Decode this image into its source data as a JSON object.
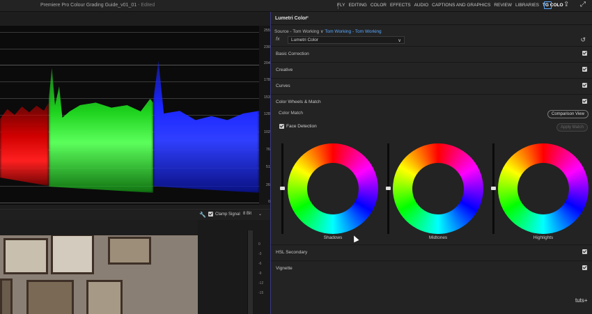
{
  "app": {
    "title": "Premiere Pro Colour Grading Guide_v01_01",
    "status": "- Edited"
  },
  "workspace_tabs": [
    "FLY",
    "EDITING",
    "COLOR",
    "EFFECTS",
    "AUDIO",
    "CAPTIONS AND GRAPHICS",
    "REVIEW",
    "LIBRARIES",
    "TG COLO"
  ],
  "workspace_active": "TG COLO",
  "scope": {
    "type": "RGB parade",
    "y_labels": [
      "255",
      "230",
      "204",
      "178",
      "153",
      "128",
      "102",
      "76",
      "51",
      "26",
      "0"
    ],
    "channels": [
      {
        "name": "red",
        "color": "#ff1a1a"
      },
      {
        "name": "green",
        "color": "#22dd22"
      },
      {
        "name": "blue",
        "color": "#2233ff"
      }
    ]
  },
  "scope_tools": {
    "clamp_label": "Clamp Signal",
    "clamp_checked": true,
    "bit_depth": "8 Bit"
  },
  "meter": {
    "labels": [
      "0",
      "-3",
      "-6",
      "-9",
      "-12",
      "-15"
    ]
  },
  "lumetri": {
    "panel_title": "Lumetri Color",
    "menu_icon": "≡",
    "source_label": "Source - Tom Working",
    "source_arrow": "∨",
    "target_label": "Tom Working - Tom Working",
    "fx_label": "fx",
    "effect_name": "Lumetri Color",
    "effect_arrow": "∨",
    "sections": [
      {
        "label": "Basic Correction",
        "enabled": true
      },
      {
        "label": "Creative",
        "enabled": true
      },
      {
        "label": "Curves",
        "enabled": true
      },
      {
        "label": "Color Wheels & Match",
        "enabled": true
      }
    ],
    "color_match_label": "Color Match",
    "comparison_button": "Comparison View",
    "face_detection_label": "Face Detection",
    "face_detection_checked": true,
    "apply_match_button": "Apply Match",
    "wheels": [
      {
        "label": "Shadows"
      },
      {
        "label": "Midtones"
      },
      {
        "label": "Highlights"
      }
    ],
    "bottom_sections": [
      {
        "label": "HSL Secondary",
        "enabled": true
      },
      {
        "label": "Vignette",
        "enabled": true
      }
    ]
  },
  "watermark": "tuts+",
  "colors": {
    "accent_blue": "#5aa9ff",
    "panel_bg": "#232323",
    "scope_bg": "#0b0b0b"
  }
}
